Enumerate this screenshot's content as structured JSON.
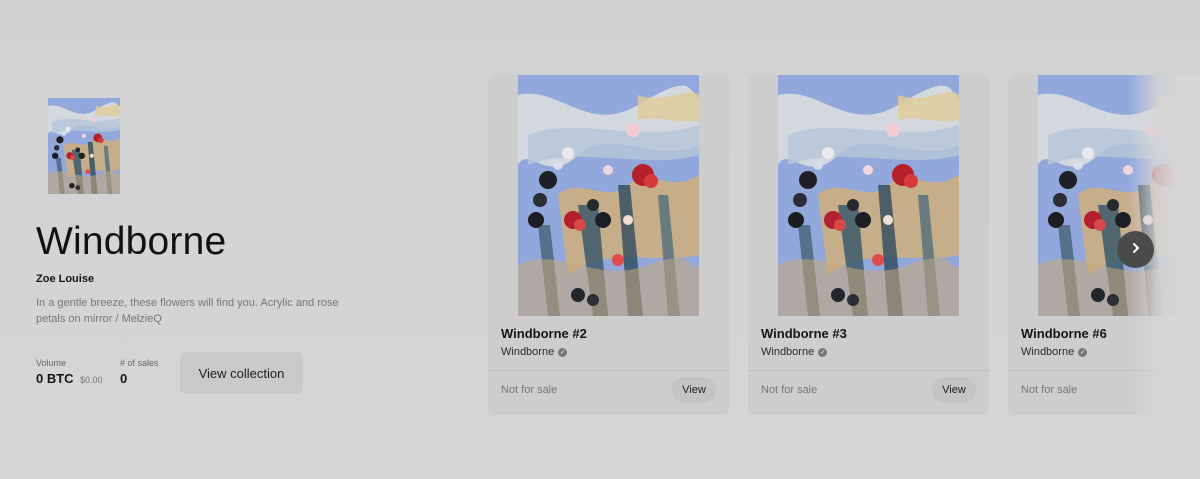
{
  "collection": {
    "title": "Windborne",
    "artist": "Zoe Louise",
    "description": "In a gentle breeze, these flowers will find you. Acrylic and rose petals on mirror / MelzieQ",
    "thumbnail_icon": "painting-thumbnail",
    "stats": {
      "volume_label": "Volume",
      "volume_value": "0 BTC",
      "volume_fiat": "$0.00",
      "sales_label": "# of sales",
      "sales_value": "0"
    },
    "view_collection_label": "View collection"
  },
  "cards": [
    {
      "name": "Windborne #2",
      "collection": "Windborne",
      "status": "Not for sale",
      "view_label": "View"
    },
    {
      "name": "Windborne #3",
      "collection": "Windborne",
      "status": "Not for sale",
      "view_label": "View"
    },
    {
      "name": "Windborne #6",
      "collection": "Windborne",
      "status": "Not for sale"
    }
  ],
  "carousel": {
    "next_icon": "chevron-right-icon"
  },
  "colors": {
    "background": "#d4d4d4",
    "card": "#cdcdcd",
    "next_button": "#4a4a4a"
  }
}
